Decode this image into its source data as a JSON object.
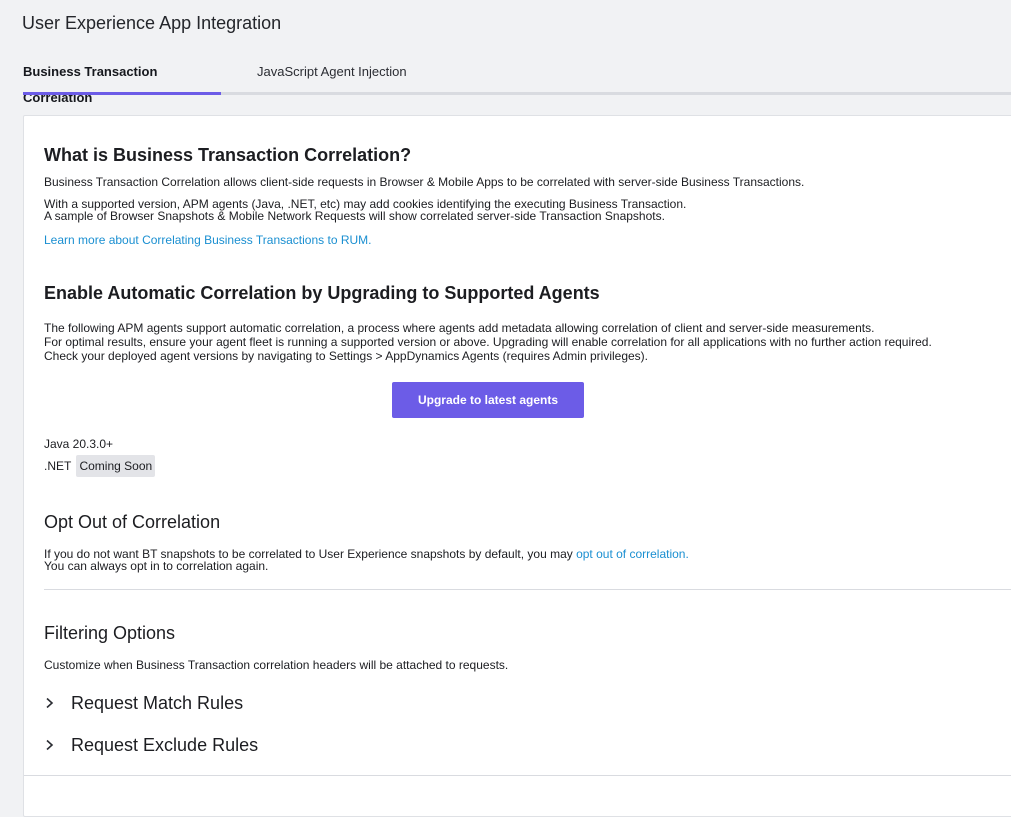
{
  "app": {
    "title": "User Experience App Integration"
  },
  "tabs": [
    {
      "label": "Business Transaction Correlation",
      "active": true
    },
    {
      "label": "JavaScript Agent Injection",
      "active": false
    }
  ],
  "colors": {
    "accent": "#6c5ce7",
    "link": "#1a8fd1",
    "background": "#f1f2f4",
    "panel": "#ffffff"
  },
  "what_is": {
    "heading": "What is Business Transaction Correlation?",
    "line1": "Business Transaction Correlation allows client-side requests in Browser & Mobile Apps to be correlated with server-side Business Transactions.",
    "line2": "With a supported version, APM agents (Java, .NET, etc) may add cookies identifying the executing Business Transaction.",
    "line3": "A sample of Browser Snapshots & Mobile Network Requests will show correlated server-side Transaction Snapshots.",
    "learn_more": "Learn more about Correlating Business Transactions to RUM."
  },
  "enable": {
    "heading": "Enable Automatic Correlation by Upgrading to Supported Agents",
    "line1": "The following APM agents support automatic correlation, a process where agents add metadata allowing correlation of client and server-side measurements.",
    "line2": "For optimal results, ensure your agent fleet is running a supported version or above. Upgrading will enable correlation for all applications with no further action required.",
    "line3": "Check your deployed agent versions by navigating to Settings > AppDynamics Agents (requires Admin privileges).",
    "upgrade_button": "Upgrade to latest agents",
    "agents": [
      {
        "name": "Java 20.3.0+"
      },
      {
        "name": ".NET",
        "badge": "Coming Soon"
      }
    ]
  },
  "opt_out": {
    "heading": "Opt Out of Correlation",
    "line1_prefix": "If you do not want BT snapshots to be correlated to User Experience snapshots by default, you may ",
    "line1_link": "opt out of correlation.",
    "line2": "You can always opt in to correlation again."
  },
  "filtering": {
    "heading": "Filtering Options",
    "description": "Customize when Business Transaction correlation headers will be attached to requests.",
    "rules": [
      {
        "label": "Request Match Rules",
        "icon": "chevron-right-icon"
      },
      {
        "label": "Request Exclude Rules",
        "icon": "chevron-right-icon"
      }
    ]
  }
}
